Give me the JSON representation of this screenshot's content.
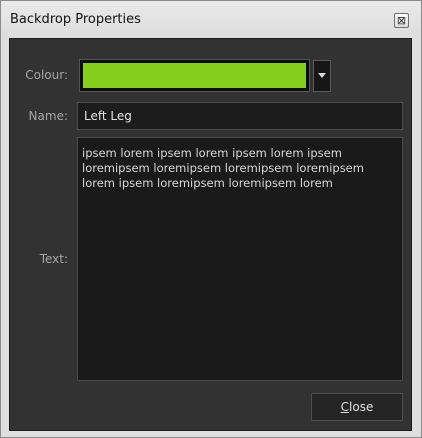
{
  "window": {
    "title": "Backdrop Properties",
    "close_icon_glyph": "⊠"
  },
  "colour": {
    "label": "Colour:",
    "value": "#84cf1d"
  },
  "name": {
    "label": "Name:",
    "value": "Left Leg"
  },
  "text": {
    "label": "Text:",
    "value": "ipsem lorem ipsem lorem ipsem lorem ipsem\nloremipsem loremipsem loremipsem loremipsem\nlorem ipsem loremipsem loremipsem lorem"
  },
  "buttons": {
    "close_mnemonic": "C",
    "close_rest": "lose"
  }
}
